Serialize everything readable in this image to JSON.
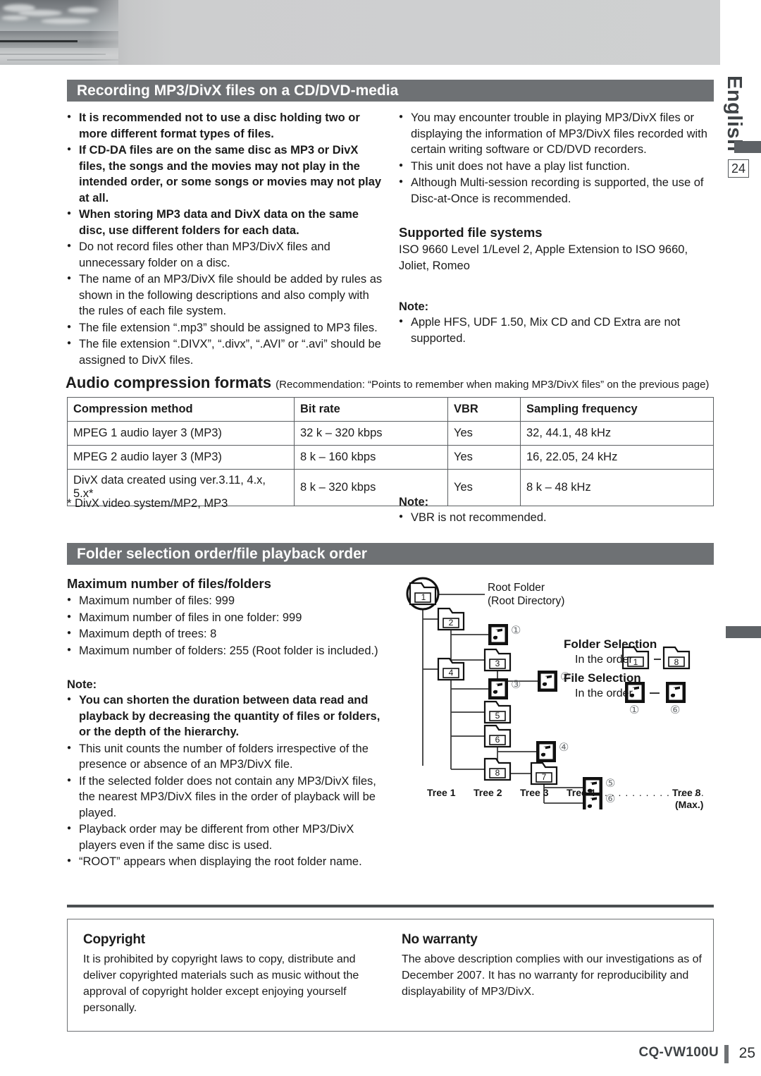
{
  "rail": {
    "language": "English",
    "chapter_page": "24"
  },
  "section1": {
    "title": "Recording MP3/DivX files on a CD/DVD-media",
    "left_bullets": [
      {
        "text": "It is recommended not to use a disc holding two or more different format types of files.",
        "bold": true
      },
      {
        "text": "If CD-DA files are on the same disc as MP3 or DivX files, the songs and the movies may not play in the intended order, or some songs or movies may not play at all.",
        "bold": true
      },
      {
        "text": "When storing MP3 data and DivX data on the same disc, use different folders for each data.",
        "bold": true
      },
      {
        "text": "Do not record files other than MP3/DivX files and unnecessary folder on a disc.",
        "bold": false
      },
      {
        "text": "The name of an MP3/DivX file should be added by rules as shown in the following descriptions and also comply with the rules of each file system.",
        "bold": false
      },
      {
        "text": "The file extension “.mp3” should be assigned to MP3 files.",
        "bold": false
      },
      {
        "text": "The file extension “.DIVX”, “.divx”, “.AVI” or “.avi” should be assigned to DivX files.",
        "bold": false
      }
    ],
    "right_bullets": [
      "You may encounter trouble in playing MP3/DivX files or displaying the information of MP3/DivX files recorded with certain writing software or CD/DVD recorders.",
      "This unit does not have a play list function.",
      "Although Multi-session recording is supported, the use of Disc-at-Once is recommended."
    ],
    "file_systems_heading": "Supported file systems",
    "file_systems_text": "ISO 9660 Level 1/Level 2, Apple Extension to ISO 9660, Joliet, Romeo",
    "note_label": "Note:",
    "note_bullets": [
      "Apple HFS, UDF 1.50, Mix CD and CD Extra are not supported."
    ]
  },
  "audio_formats": {
    "heading": "Audio compression formats",
    "heading_suffix": "(Recommendation: “Points to remember when making MP3/DivX files” on the previous page)",
    "columns": [
      "Compression method",
      "Bit rate",
      "VBR",
      "Sampling frequency"
    ],
    "rows": [
      [
        "MPEG 1 audio layer 3 (MP3)",
        "32 k – 320 kbps",
        "Yes",
        "32, 44.1, 48 kHz"
      ],
      [
        "MPEG 2 audio layer 3 (MP3)",
        "8 k – 160 kbps",
        "Yes",
        "16, 22.05, 24 kHz"
      ],
      [
        "DivX data created using ver.3.11, 4.x, 5.x*",
        "8 k – 320 kbps",
        "Yes",
        "8 k – 48 kHz"
      ]
    ],
    "footnote": "* DivX video system/MP2, MP3",
    "note_label": "Note:",
    "note_bullets": [
      "VBR is not recommended."
    ]
  },
  "section2": {
    "title": "Folder selection order/file playback order",
    "max_heading": "Maximum number of files/folders",
    "max_bullets": [
      "Maximum number of files: 999",
      "Maximum number of files in one folder: 999",
      "Maximum depth of trees: 8",
      "Maximum number of folders: 255 (Root folder is included.)"
    ],
    "note_label": "Note:",
    "note_bullets": [
      {
        "text": "You can shorten the duration between data read and playback by decreasing the quantity of files or folders, or the depth of the hierarchy.",
        "bold": true
      },
      {
        "text": "This unit counts the number of folders irrespective of the presence or absence of an MP3/DivX file.",
        "bold": false
      },
      {
        "text": "If the selected folder does not contain any MP3/DivX files, the nearest MP3/DivX files in the order of playback will be played.",
        "bold": false
      },
      {
        "text": "Playback order may be different from other MP3/DivX players even if the same disc is used.",
        "bold": false
      },
      {
        "text": "“ROOT” appears when displaying the root folder name.",
        "bold": false
      }
    ],
    "diagram": {
      "root_label_line1": "Root Folder",
      "root_label_line2": "(Root Directory)",
      "folder_numbers": [
        "1",
        "2",
        "3",
        "4",
        "5",
        "6",
        "7",
        "8"
      ],
      "file_numbers": [
        "①",
        "②",
        "③",
        "④",
        "⑤",
        "⑥"
      ],
      "folder_selection_heading": "Folder Selection",
      "folder_selection_text": "In the order",
      "folder_selection_from": "1",
      "folder_selection_dash": "–",
      "folder_selection_to": "8",
      "file_selection_heading": "File Selection",
      "file_selection_text": "In the order",
      "file_selection_dash": "–",
      "file_selection_from": "①",
      "file_selection_to": "⑥",
      "tree_labels": [
        "Tree 1",
        "Tree 2",
        "Tree 3",
        "Tree 4",
        "Tree 8"
      ],
      "tree_dots": ". . . . . . . . . . . . . . .",
      "tree_max": "(Max.)"
    }
  },
  "copyright": {
    "heading": "Copyright",
    "body": "It is prohibited by copyright laws to copy, distribute and deliver copyrighted materials such as music without the approval of copyright holder except enjoying yourself personally."
  },
  "warranty": {
    "heading": "No warranty",
    "body": "The above description complies with our investigations as of December 2007. It has no warranty for reproducibility and displayability of MP3/DivX."
  },
  "footer": {
    "model": "CQ-VW100U",
    "page": "25"
  }
}
